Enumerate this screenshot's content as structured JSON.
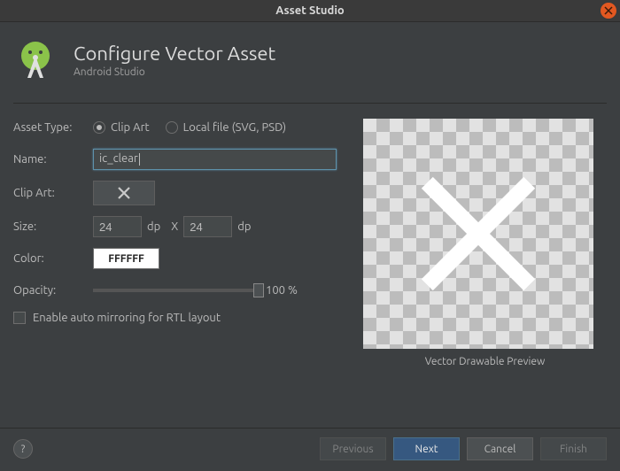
{
  "titlebar": {
    "title": "Asset Studio"
  },
  "header": {
    "title": "Configure Vector Asset",
    "subtitle": "Android Studio"
  },
  "form": {
    "asset_type_label": "Asset Type:",
    "asset_type_options": {
      "clipart": "Clip Art",
      "localfile": "Local file (SVG, PSD)"
    },
    "name_label": "Name:",
    "name_value": "ic_clear",
    "clipart_label": "Clip Art:",
    "size_label": "Size:",
    "size_width": "24",
    "size_height": "24",
    "size_unit": "dp",
    "size_sep": "X",
    "color_label": "Color:",
    "color_value": "FFFFFF",
    "opacity_label": "Opacity:",
    "opacity_value": "100 %",
    "mirror_label": "Enable auto mirroring for RTL layout"
  },
  "preview": {
    "label": "Vector Drawable Preview"
  },
  "footer": {
    "help": "?",
    "previous": "Previous",
    "next": "Next",
    "cancel": "Cancel",
    "finish": "Finish"
  }
}
